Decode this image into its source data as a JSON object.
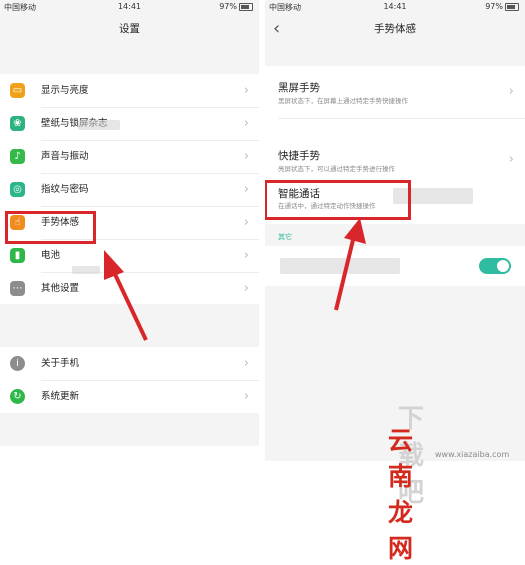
{
  "status_bar": {
    "carrier": "中国移动",
    "time": "14:41",
    "battery": "97%"
  },
  "left_screen": {
    "title": "设置",
    "items": [
      {
        "label": "显示与亮度",
        "icon": "display-icon",
        "color": "#f0a11b"
      },
      {
        "label": "壁纸与锁屏杂志",
        "icon": "wallpaper-icon",
        "color": "#2db37f"
      },
      {
        "label": "声音与振动",
        "icon": "sound-icon",
        "color": "#35b949"
      },
      {
        "label": "指纹与密码",
        "icon": "fingerprint-icon",
        "color": "#2bb58a"
      },
      {
        "label": "手势体感",
        "icon": "gesture-icon",
        "color": "#f08b1e"
      },
      {
        "label": "电池",
        "icon": "battery-icon",
        "color": "#2fb84a"
      },
      {
        "label": "其他设置",
        "icon": "more-icon",
        "color": "#8d8d8d"
      },
      {
        "label": "关于手机",
        "icon": "info-icon",
        "color": "#8d8d8d"
      },
      {
        "label": "系统更新",
        "icon": "update-icon",
        "color": "#2fb84a"
      }
    ]
  },
  "right_screen": {
    "title": "手势体感",
    "items": [
      {
        "title": "黑屏手势",
        "subtitle": "黑屏状态下，在屏幕上通过特定手势快捷操作"
      },
      {
        "title": "快捷手势",
        "subtitle": "亮屏状态下，可以通过特定手势进行操作"
      },
      {
        "title": "智能通话",
        "subtitle": "在通话中，通过特定动作快捷操作"
      }
    ],
    "section_label": "其它",
    "toggle_on": true
  },
  "watermark": {
    "brand": "云南龙网",
    "site": "www.xiazaiba.com",
    "logo": "下载吧"
  },
  "colors": {
    "highlight": "#d8262a",
    "accent": "#2fbca0"
  }
}
